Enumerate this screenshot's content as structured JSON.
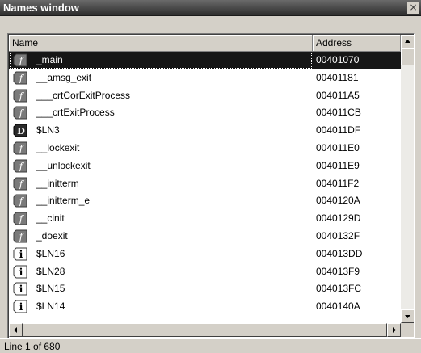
{
  "window": {
    "title": "Names window",
    "close_glyph": "×"
  },
  "columns": {
    "name": "Name",
    "address": "Address"
  },
  "rows": [
    {
      "kind": "f",
      "name": "_main",
      "address": "00401070",
      "selected": true
    },
    {
      "kind": "f",
      "name": "__amsg_exit",
      "address": "00401181"
    },
    {
      "kind": "f",
      "name": "___crtCorExitProcess",
      "address": "004011A5"
    },
    {
      "kind": "f",
      "name": "___crtExitProcess",
      "address": "004011CB"
    },
    {
      "kind": "D",
      "name": "$LN3",
      "address": "004011DF"
    },
    {
      "kind": "f",
      "name": "__lockexit",
      "address": "004011E0"
    },
    {
      "kind": "f",
      "name": "__unlockexit",
      "address": "004011E9"
    },
    {
      "kind": "f",
      "name": "__initterm",
      "address": "004011F2"
    },
    {
      "kind": "f",
      "name": "__initterm_e",
      "address": "0040120A"
    },
    {
      "kind": "f",
      "name": "__cinit",
      "address": "0040129D"
    },
    {
      "kind": "f",
      "name": "_doexit",
      "address": "0040132F"
    },
    {
      "kind": "i",
      "name": "$LN16",
      "address": "004013DD"
    },
    {
      "kind": "i",
      "name": "$LN28",
      "address": "004013F9"
    },
    {
      "kind": "i",
      "name": "$LN15",
      "address": "004013FC"
    },
    {
      "kind": "i",
      "name": "$LN14",
      "address": "0040140A"
    }
  ],
  "icons": {
    "f": "function-icon",
    "D": "data-icon",
    "i": "instruction-icon"
  },
  "status": "Line 1 of 680"
}
